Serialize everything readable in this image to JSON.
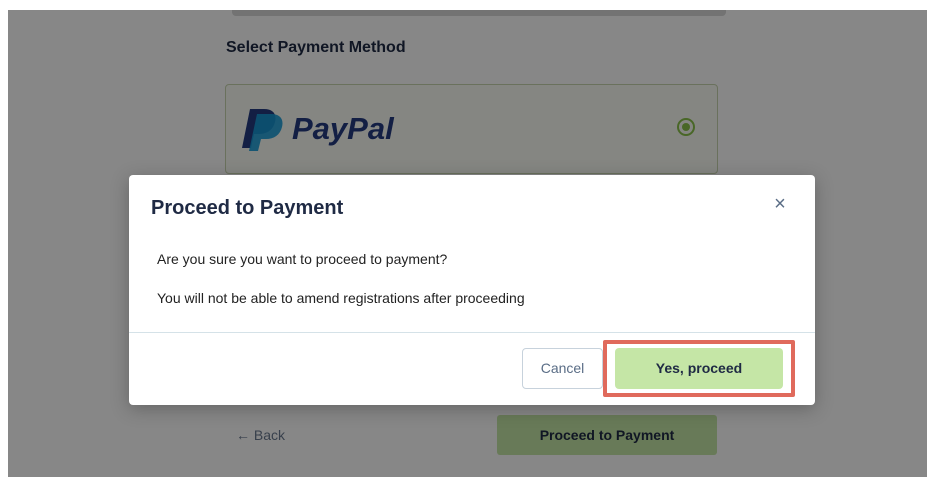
{
  "background": {
    "section_title": "Select Payment Method",
    "payment_option": {
      "logo_text": "PayPal",
      "selected": true
    },
    "back_label": "← Back",
    "proceed_button_label": "Proceed to Payment"
  },
  "modal": {
    "title": "Proceed to Payment",
    "close_icon": "×",
    "message_line1": "Are you sure you want to proceed to payment?",
    "message_line2": "You will not be able to amend registrations after proceeding",
    "cancel_label": "Cancel",
    "confirm_label": "Yes, proceed"
  },
  "colors": {
    "accent_green": "#c5e6a6",
    "highlight_red": "#e06a5c",
    "paypal_dark_blue": "#253b80",
    "paypal_light_blue": "#179bd7"
  }
}
